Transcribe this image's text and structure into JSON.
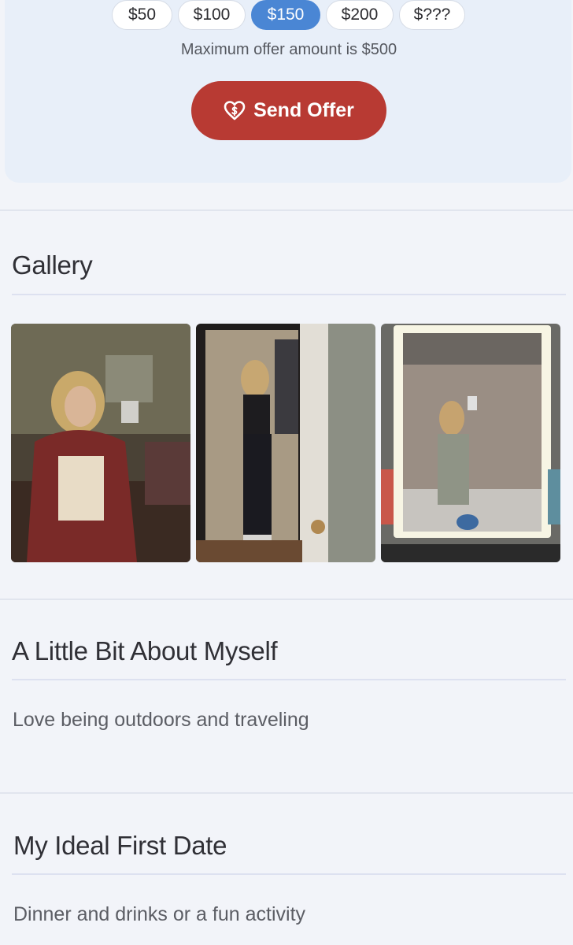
{
  "offer": {
    "amounts": [
      {
        "label": "$50",
        "selected": false
      },
      {
        "label": "$100",
        "selected": false
      },
      {
        "label": "$150",
        "selected": true
      },
      {
        "label": "$200",
        "selected": false
      },
      {
        "label": "$???",
        "selected": false
      }
    ],
    "max_note": "Maximum offer amount is $500",
    "send_label": "Send Offer",
    "send_icon": "heart-dollar-icon",
    "selected_color": "#4a86d4",
    "button_color": "#b83a33"
  },
  "gallery": {
    "title": "Gallery",
    "photos": [
      {
        "alt": "mirror-selfie-bedroom"
      },
      {
        "alt": "mirror-selfie-door"
      },
      {
        "alt": "mirror-selfie-bathroom"
      }
    ]
  },
  "about": {
    "title": "A Little Bit About Myself",
    "text": "Love being outdoors and traveling"
  },
  "first_date": {
    "title": "My Ideal First Date",
    "text": "Dinner and drinks or a fun activity"
  }
}
